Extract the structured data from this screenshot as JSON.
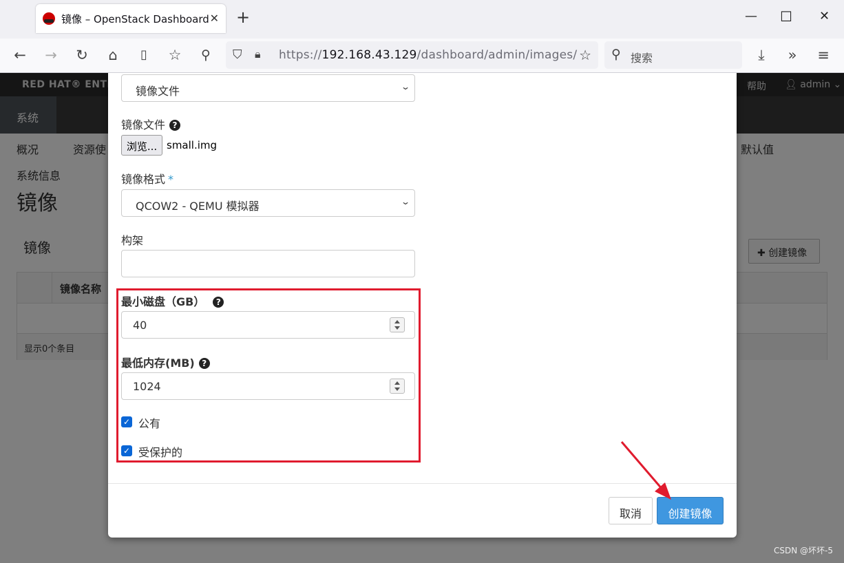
{
  "browser": {
    "tab_title": "镜像 – OpenStack Dashboard",
    "url_prefix": "https://",
    "url_host": "192.168.43.129",
    "url_path": "/dashboard/admin/images/",
    "search_placeholder": "搜索"
  },
  "dashboard": {
    "brand": "RED HAT® ENTER",
    "help": "帮助",
    "user": "admin",
    "system_tab": "系统",
    "subnav": [
      "概况",
      "资源使",
      "默认值",
      "系统信息"
    ],
    "page_title": "镜像",
    "panel_title": "镜像",
    "create_button": "创建镜像",
    "table_header_name": "镜像名称",
    "table_footer": "显示0个条目"
  },
  "modal": {
    "source_select_value": "镜像文件",
    "file_label": "镜像文件",
    "browse_button": "浏览...",
    "file_name": "small.img",
    "format_label": "镜像格式",
    "format_required": "*",
    "format_value": "QCOW2 - QEMU 模拟器",
    "arch_label": "构架",
    "arch_value": "",
    "min_disk_label": "最小磁盘（GB）",
    "min_disk_value": "40",
    "min_ram_label": "最低内存(MB)",
    "min_ram_value": "1024",
    "public_label": "公有",
    "public_checked": true,
    "protected_label": "受保护的",
    "protected_checked": true,
    "cancel_button": "取消",
    "submit_button": "创建镜像"
  },
  "watermark": "CSDN @坏坏-5",
  "colors": {
    "highlight": "#e01b2e",
    "primary_button": "#3f97e0",
    "checkbox": "#0a66d6"
  }
}
